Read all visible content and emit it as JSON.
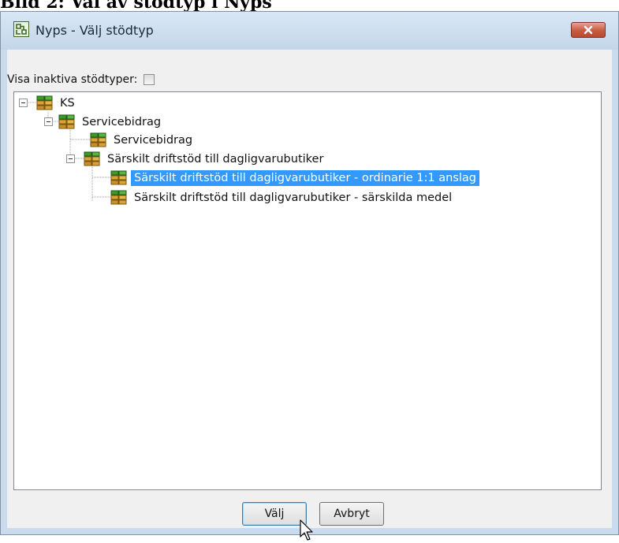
{
  "document": {
    "caption": "Bild 2: Val av stödtyp i Nyps"
  },
  "window": {
    "title": "Nyps - Välj stödtyp",
    "app_icon": "nyps-app-icon",
    "close_icon": "close-icon"
  },
  "options": {
    "show_inactive_label": "Visa inaktiva stödtyper:",
    "show_inactive_checked": false
  },
  "tree": {
    "nodes": [
      {
        "label": "KS",
        "level": 0,
        "expanded": true,
        "icon": "funding-stack-icon"
      },
      {
        "label": "Servicebidrag",
        "level": 1,
        "expanded": true,
        "icon": "funding-stack-icon"
      },
      {
        "label": "Servicebidrag",
        "level": 2,
        "icon": "funding-stack-icon"
      },
      {
        "label": "Särskilt driftstöd till dagligvarubutiker",
        "level": 2,
        "expanded": true,
        "icon": "funding-stack-icon"
      },
      {
        "label": "Särskilt driftstöd till dagligvarubutiker - ordinarie 1:1 anslag",
        "level": 3,
        "selected": true,
        "icon": "funding-stack-icon"
      },
      {
        "label": "Särskilt driftstöd till dagligvarubutiker - särskilda medel",
        "level": 3,
        "icon": "funding-stack-icon"
      }
    ],
    "selection_color": "#3399ff"
  },
  "buttons": {
    "ok_label": "Välj",
    "cancel_label": "Avbryt"
  }
}
